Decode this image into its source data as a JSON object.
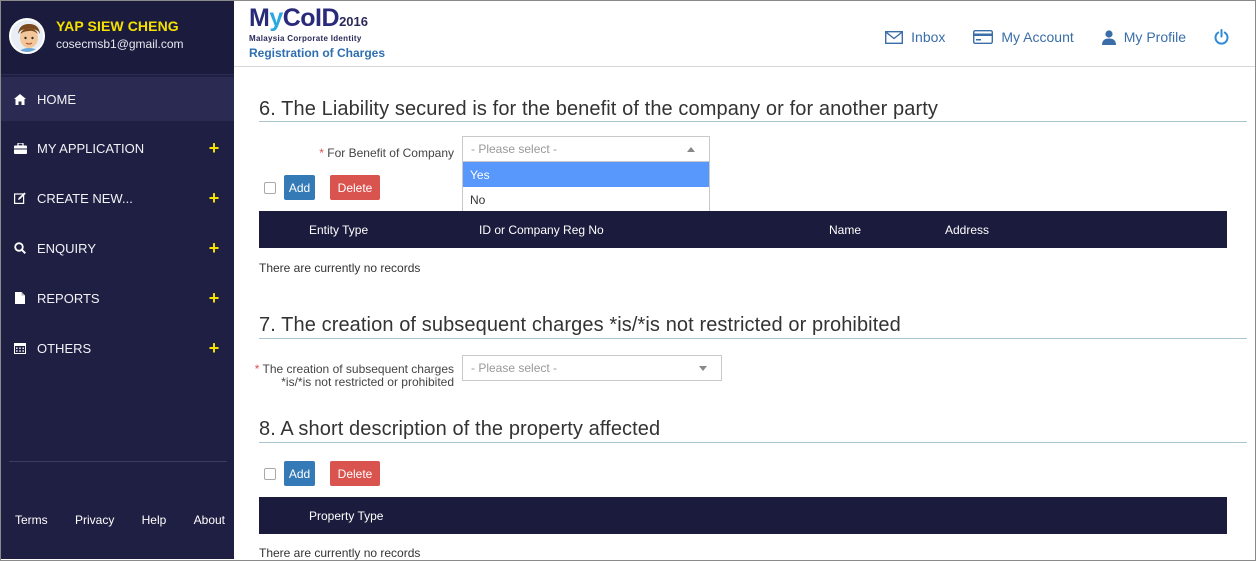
{
  "user": {
    "name": "YAP SIEW CHENG",
    "email": "cosecmsb1@gmail.com"
  },
  "nav": {
    "home": "HOME",
    "items": [
      {
        "label": "MY APPLICATION",
        "icon": "briefcase-icon"
      },
      {
        "label": "CREATE NEW...",
        "icon": "edit-icon"
      },
      {
        "label": "ENQUIRY",
        "icon": "search-icon"
      },
      {
        "label": "REPORTS",
        "icon": "file-icon"
      },
      {
        "label": "OTHERS",
        "icon": "calendar-icon"
      }
    ],
    "plus": "+"
  },
  "footer": {
    "terms": "Terms",
    "privacy": "Privacy",
    "help": "Help",
    "about": "About"
  },
  "logo": {
    "main_a": "M",
    "main_y": "y",
    "main_b": "CoID",
    "year": "2016",
    "sub": "Malaysia Corporate Identity",
    "title": "Registration of Charges"
  },
  "top": {
    "inbox": "Inbox",
    "account": "My Account",
    "profile": "My Profile"
  },
  "section6": {
    "title": "6. The Liability secured is for the benefit of the company or for another party",
    "label_req": "*",
    "label": "For Benefit of Company",
    "select_placeholder": "- Please select -",
    "options": [
      "Yes",
      "No"
    ],
    "add": "Add",
    "delete": "Delete",
    "columns": [
      "Entity Type",
      "ID or Company Reg No",
      "Name",
      "Address"
    ],
    "empty": "There are currently no records"
  },
  "section7": {
    "title": "7. The creation of subsequent charges *is/*is not restricted or prohibited",
    "label_req": "*",
    "label_line1": "The creation of subsequent charges",
    "label_line2": "*is/*is not restricted or prohibited",
    "select_placeholder": "- Please select -"
  },
  "section8": {
    "title": "8. A short description of the property affected",
    "add": "Add",
    "delete": "Delete",
    "columns": [
      "Property Type"
    ],
    "empty": "There are currently no records"
  },
  "colors": {
    "sidebar": "#1f1f44",
    "table_header": "#1b1b3d",
    "accent_yellow": "#f5e000",
    "link_blue": "#3a6ea8",
    "add_blue": "#337ab7",
    "delete_red": "#d9534f",
    "option_highlight": "#5897fb"
  }
}
